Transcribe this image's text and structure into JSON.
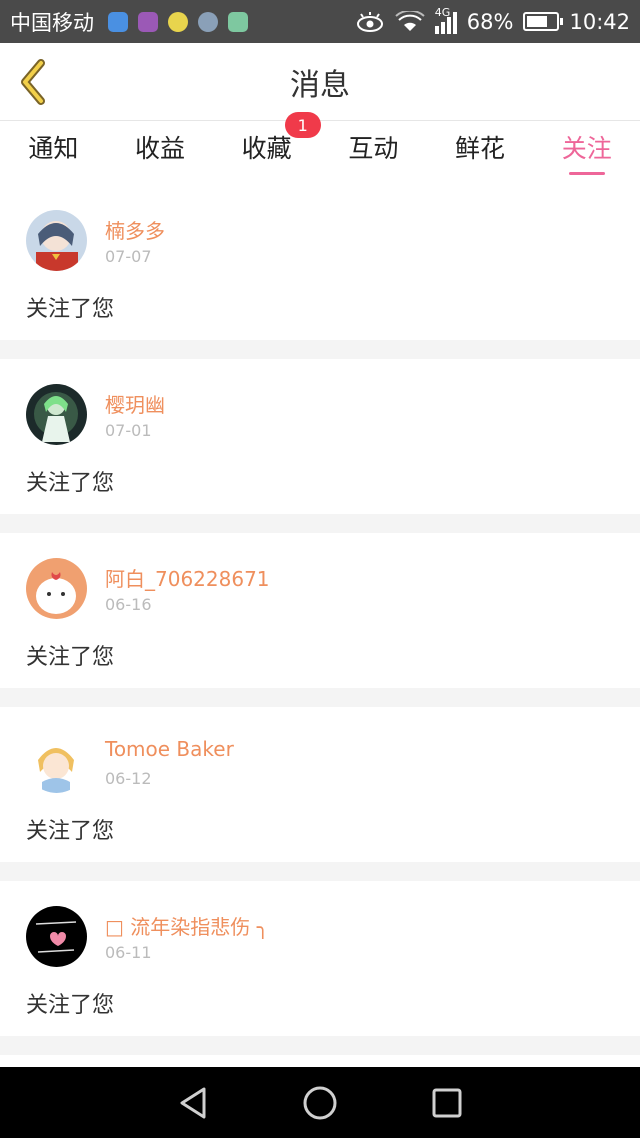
{
  "status_bar": {
    "carrier": "中国移动",
    "network": "4G",
    "battery": "68%",
    "time": "10:42",
    "app_icons": [
      "location-app-icon",
      "gallery-app-icon",
      "chat-app-icon",
      "camera-app-icon",
      "game-app-icon"
    ]
  },
  "header": {
    "title": "消息",
    "back_icon": "chevron-left-icon"
  },
  "tabs": [
    {
      "label": "通知",
      "active": false
    },
    {
      "label": "收益",
      "active": false
    },
    {
      "label": "收藏",
      "active": false,
      "badge": "1"
    },
    {
      "label": "互动",
      "active": false
    },
    {
      "label": "鲜花",
      "active": false
    },
    {
      "label": "关注",
      "active": true
    }
  ],
  "notifications": [
    {
      "name": "楠多多",
      "date": "07-07",
      "text": "关注了您"
    },
    {
      "name": "樱玥幽",
      "date": "07-01",
      "text": "关注了您"
    },
    {
      "name": "阿白_706228671",
      "date": "06-16",
      "text": "关注了您"
    },
    {
      "name": "Tomoe Baker",
      "date": "06-12",
      "text": "关注了您"
    },
    {
      "name": "□ 流年染指悲伤 ╮",
      "date": "06-11",
      "text": "关注了您"
    }
  ],
  "colors": {
    "accent": "#ee6699",
    "username": "#ef8f5d",
    "badge": "#f03a4a"
  },
  "nav_bar": {
    "back": "triangle-back-icon",
    "home": "circle-home-icon",
    "recents": "square-recents-icon"
  }
}
